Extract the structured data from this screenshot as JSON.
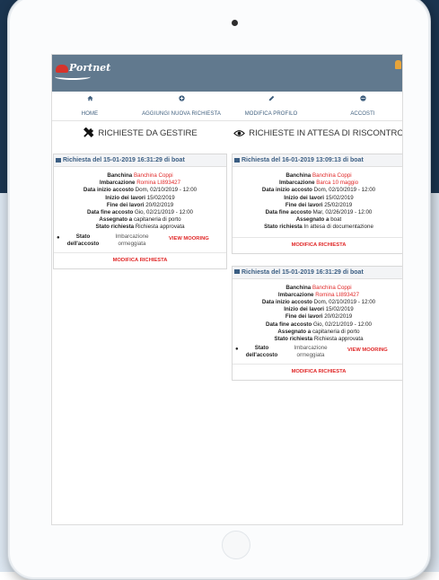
{
  "app": {
    "logo_text": "Portnet",
    "brand_color": "#61798e",
    "accent_color": "#e02828"
  },
  "nav": {
    "items": [
      {
        "label": "HOME",
        "icon": "home-icon"
      },
      {
        "label": "AGGIUNGI NUOVA RICHIESTA",
        "icon": "plus-circle-icon"
      },
      {
        "label": "MODIFICA PROFILO",
        "icon": "pencil-icon"
      },
      {
        "label": "ACCOSTI",
        "icon": "ship-icon"
      }
    ]
  },
  "left": {
    "title": "RICHIESTE DA GESTIRE",
    "title_icon": "tools-icon",
    "cards": [
      {
        "header": "Richiesta del 15-01-2019 16:31:29 di boat",
        "banchina_label": "Banchina",
        "banchina_value": "Banchina Coppi",
        "imbarcazione_label": "Imbarcazione",
        "imbarcazione_value": "Romina LI893427",
        "data_inizio_label": "Data inizio accosto",
        "data_inizio_value": "Dom, 02/10/2019 - 12:00",
        "inizio_lavori_label": "Inizio dei lavori",
        "inizio_lavori_value": "15/02/2019",
        "fine_lavori_label": "Fine dei lavori",
        "fine_lavori_value": "20/02/2019",
        "data_fine_label": "Data fine accosto",
        "data_fine_value": "Gio, 02/21/2019 - 12:00",
        "assegnato_label": "Assegnato a",
        "assegnato_value": "capitaneria di porto",
        "stato_richiesta_label": "Stato richiesta",
        "stato_richiesta_value": "Richiesta approvata",
        "stato_accosto_label": "Stato dell'accosto",
        "stato_accosto_value": "Imbarcazione ormeggiata",
        "view_mooring": "VIEW MOORING",
        "action": "MODIFICA RICHIESTA"
      }
    ]
  },
  "right": {
    "title": "RICHIESTE IN ATTESA DI RISCONTRO",
    "title_icon": "eye-icon",
    "cards": [
      {
        "header": "Richiesta del 16-01-2019 13:09:13 di boat",
        "banchina_label": "Banchina",
        "banchina_value": "Banchina Coppi",
        "imbarcazione_label": "Imbarcazione",
        "imbarcazione_value": "Barca 10 maggio",
        "data_inizio_label": "Data inizio accosto",
        "data_inizio_value": "Dom, 02/10/2019 - 12:00",
        "inizio_lavori_label": "Inizio dei lavori",
        "inizio_lavori_value": "15/02/2019",
        "fine_lavori_label": "Fine dei lavori",
        "fine_lavori_value": "25/02/2019",
        "data_fine_label": "Data fine accosto",
        "data_fine_value": "Mar, 02/26/2019 - 12:00",
        "assegnato_label": "Assegnato a",
        "assegnato_value": "boat",
        "stato_richiesta_label": "Stato richiesta",
        "stato_richiesta_value": "In attesa di documentazione",
        "action": "MODIFICA RICHIESTA"
      },
      {
        "header": "Richiesta del 15-01-2019 16:31:29 di boat",
        "banchina_label": "Banchina",
        "banchina_value": "Banchina Coppi",
        "imbarcazione_label": "Imbarcazione",
        "imbarcazione_value": "Romina LI893427",
        "data_inizio_label": "Data inizio accosto",
        "data_inizio_value": "Dom, 02/10/2019 - 12:00",
        "inizio_lavori_label": "Inizio dei lavori",
        "inizio_lavori_value": "15/02/2019",
        "fine_lavori_label": "Fine dei lavori",
        "fine_lavori_value": "20/02/2019",
        "data_fine_label": "Data fine accosto",
        "data_fine_value": "Gio, 02/21/2019 - 12:00",
        "assegnato_label": "Assegnato a",
        "assegnato_value": "capitaneria di porto",
        "stato_richiesta_label": "Stato richiesta",
        "stato_richiesta_value": "Richiesta approvata",
        "stato_accosto_label": "Stato dell'accosto",
        "stato_accosto_value": "Imbarcazione ormeggiata",
        "view_mooring": "VIEW MOORING",
        "action": "MODIFICA RICHIESTA"
      }
    ]
  }
}
